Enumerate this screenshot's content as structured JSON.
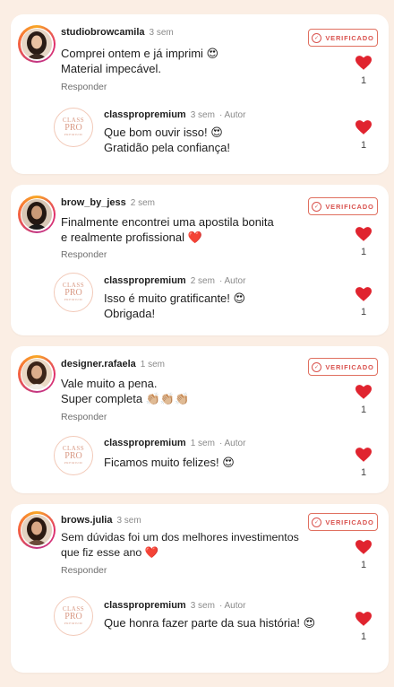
{
  "verified_label": "VERIFICADO",
  "reply_label": "Responder",
  "logo": {
    "line1": "CLASS",
    "line2": "PRO",
    "line3": "PREMIUM"
  },
  "colors": {
    "heart": "#e0242f",
    "verified": "#d9534f",
    "background": "#fbeee4"
  },
  "threads": [
    {
      "comment": {
        "username": "studiobrowcamila",
        "time": "3 sem",
        "lines": [
          "Comprei ontem e já imprimi 😍",
          "Material impecável."
        ],
        "likes": "1"
      },
      "reply": {
        "username": "classpropremium",
        "time": "3 sem",
        "author_tag": "· Autor",
        "lines": [
          "Que bom ouvir isso! 😍",
          "Gratidão pela confiança!"
        ],
        "likes": "1"
      }
    },
    {
      "comment": {
        "username": "brow_by_jess",
        "time": "2 sem",
        "lines": [
          "Finalmente encontrei uma apostila bonita",
          "e realmente profissional ❤️"
        ],
        "likes": "1"
      },
      "reply": {
        "username": "classpropremium",
        "time": "2 sem",
        "author_tag": "· Autor",
        "lines": [
          "Isso é muito gratificante! 😍",
          "Obrigada!"
        ],
        "likes": "1"
      }
    },
    {
      "comment": {
        "username": "designer.rafaela",
        "time": "1 sem",
        "lines": [
          "Vale muito a pena.",
          "Super completa 👏🏼👏🏼👏🏼"
        ],
        "likes": "1"
      },
      "reply": {
        "username": "classpropremium",
        "time": "1 sem",
        "author_tag": "· Autor",
        "lines": [
          "Ficamos muito felizes! 😍"
        ],
        "likes": "1"
      }
    },
    {
      "comment": {
        "username": "brows.julia",
        "time": "3 sem",
        "lines": [
          "Sem dúvidas foi um dos melhores investimentos",
          "que fiz esse ano ❤️"
        ],
        "likes": "1"
      },
      "reply": {
        "username": "classpropremium",
        "time": "3 sem",
        "author_tag": "· Autor",
        "lines": [
          "Que honra fazer parte da sua história! 😍"
        ],
        "likes": "1"
      }
    }
  ]
}
